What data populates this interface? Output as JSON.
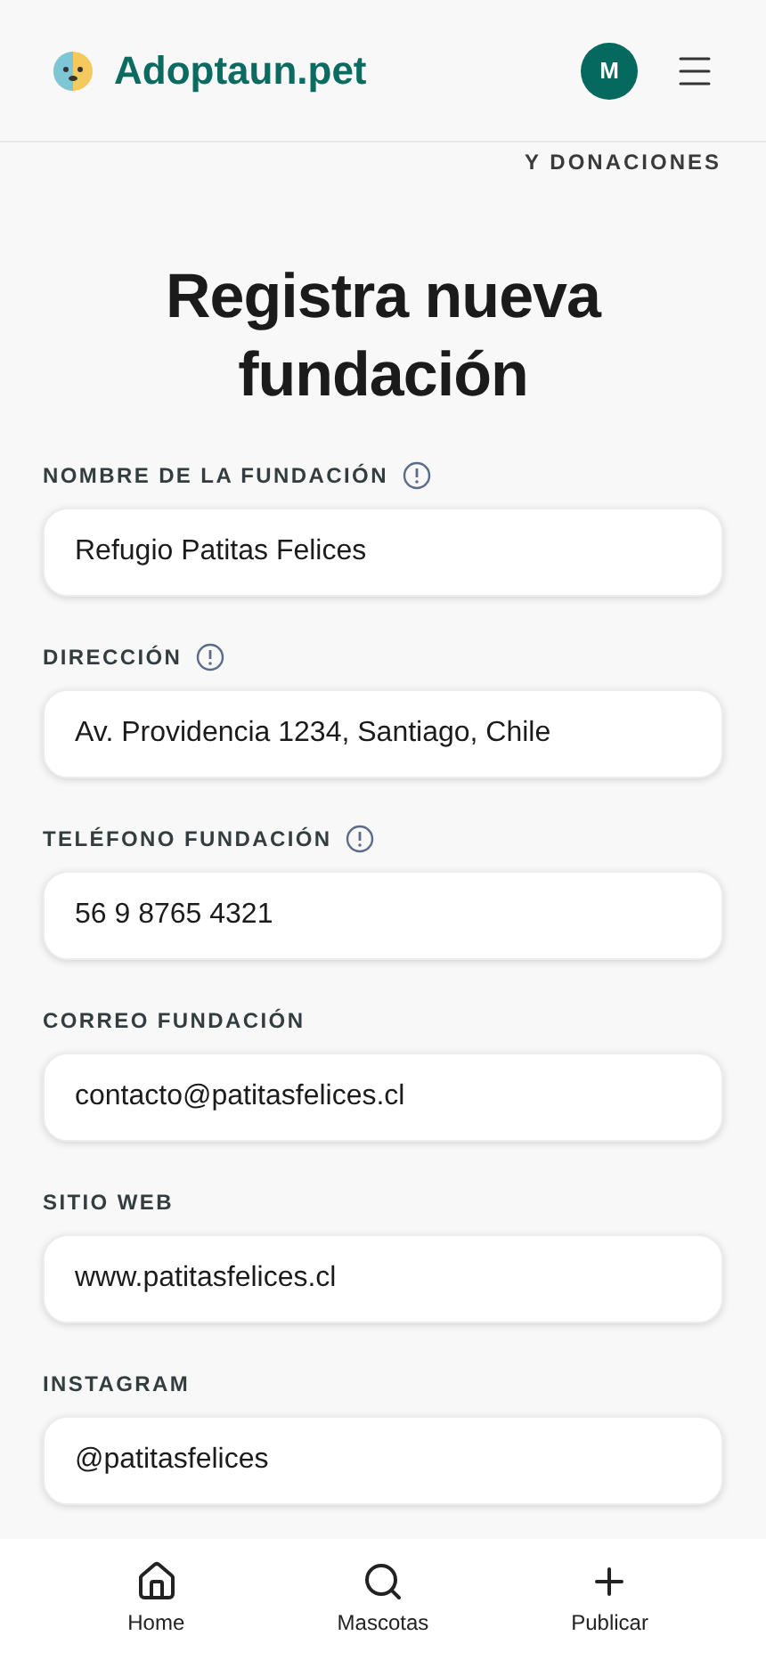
{
  "header": {
    "brand": "Adoptaun.pet",
    "avatar_initial": "M"
  },
  "breadcrumb": "Y DONACIONES",
  "title": "Registra nueva fundación",
  "fields": [
    {
      "label": "NOMBRE DE LA FUNDACIÓN",
      "info": true,
      "value": "Refugio Patitas Felices"
    },
    {
      "label": "DIRECCIÓN",
      "info": true,
      "value": "Av. Providencia 1234, Santiago, Chile"
    },
    {
      "label": "TELÉFONO FUNDACIÓN",
      "info": true,
      "value": "56 9 8765 4321"
    },
    {
      "label": "CORREO FUNDACIÓN",
      "info": false,
      "value": "contacto@patitasfelices.cl"
    },
    {
      "label": "SITIO WEB",
      "info": false,
      "value": "www.patitasfelices.cl"
    },
    {
      "label": "INSTAGRAM",
      "info": false,
      "value": "@patitasfelices"
    }
  ],
  "bottom_nav": [
    {
      "kind": "home",
      "label": "Home"
    },
    {
      "kind": "search",
      "label": "Mascotas"
    },
    {
      "kind": "plus",
      "label": "Publicar"
    }
  ]
}
